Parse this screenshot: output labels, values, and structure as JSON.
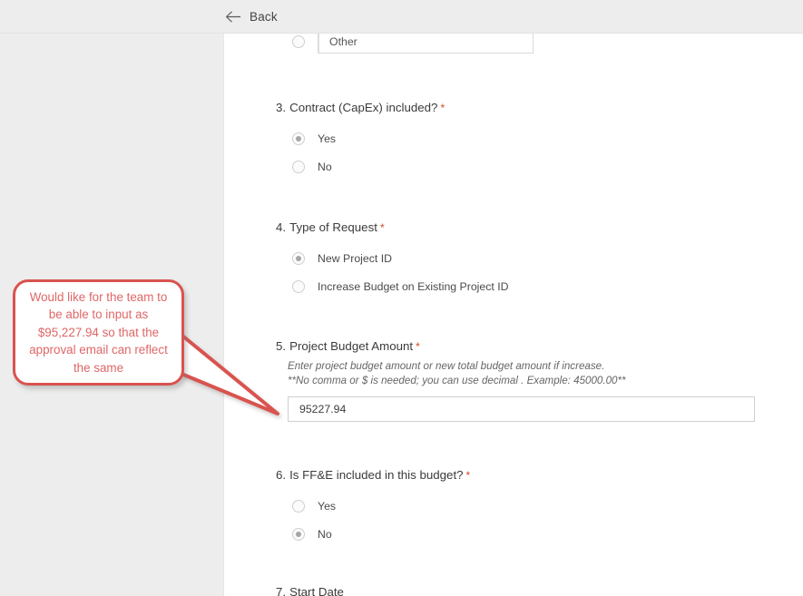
{
  "topbar": {
    "back_label": "Back",
    "back_icon": "arrow-left-icon"
  },
  "form": {
    "other_option": {
      "label": "",
      "field_text": "Other"
    },
    "questions": [
      {
        "number": "3.",
        "title": "Contract (CapEx) included?",
        "required": "*",
        "options": [
          {
            "label": "Yes",
            "selected": true
          },
          {
            "label": "No",
            "selected": false
          }
        ]
      },
      {
        "number": "4.",
        "title": "Type of Request",
        "required": "*",
        "options": [
          {
            "label": "New Project ID",
            "selected": true
          },
          {
            "label": "Increase Budget on Existing Project ID",
            "selected": false
          }
        ]
      },
      {
        "number": "5.",
        "title": "Project Budget Amount",
        "required": "*",
        "description_line1": "Enter project budget amount or new total budget amount if increase.",
        "description_line2": "**No comma or $ is needed; you can use decimal . Example: 45000.00**",
        "input_value": "95227.94"
      },
      {
        "number": "6.",
        "title": "Is FF&E included in this budget?",
        "required": "*",
        "options": [
          {
            "label": "Yes",
            "selected": false
          },
          {
            "label": "No",
            "selected": true
          }
        ]
      },
      {
        "number": "7.",
        "title": "Start Date",
        "required": ""
      }
    ]
  },
  "annotation": {
    "text": "Would like for the team to be able to input as $95,227.94 so that the approval email can reflect the same",
    "border_color": "#d9534f",
    "text_color": "#e06666"
  },
  "colors": {
    "page_background": "#ededed",
    "sheet_background": "#ffffff",
    "required_star": "#d24726",
    "title_text": "#3b3b3b"
  }
}
